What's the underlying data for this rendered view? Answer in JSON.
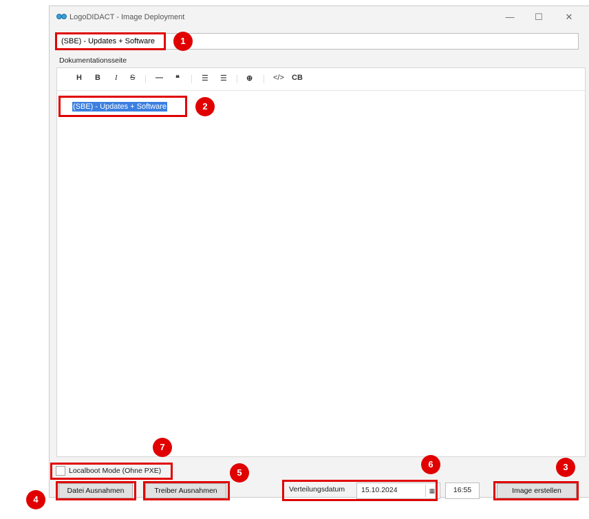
{
  "window": {
    "title": "LogoDIDACT - Image Deployment",
    "minimize": "—",
    "maximize": "☐",
    "close": "✕"
  },
  "title_field": {
    "value": "(SBE) - Updates + Software"
  },
  "doc_label": "Dokumentationsseite",
  "toolbar": {
    "heading": "H",
    "bold": "B",
    "italic": "I",
    "strike": "S",
    "hr": "—",
    "quote": "❝",
    "ul": "☰",
    "ol": "☰",
    "link": "⊕",
    "code": "</>",
    "codeblock": "CB"
  },
  "editor": {
    "content": "(SBE) - Updates + Software"
  },
  "localboot": {
    "label": "Localboot Mode (Ohne PXE)",
    "checked": false
  },
  "buttons": {
    "datei": "Datei Ausnahmen",
    "treiber": "Treiber Ausnahmen",
    "image": "Image erstellen"
  },
  "deploy": {
    "label": "Verteilungsdatum",
    "date": "15.10.2024",
    "time": "16:55"
  },
  "callouts": [
    "1",
    "2",
    "3",
    "4",
    "5",
    "6",
    "7"
  ],
  "colors": {
    "callout": "#e00000",
    "selection": "#3b7fe0"
  }
}
